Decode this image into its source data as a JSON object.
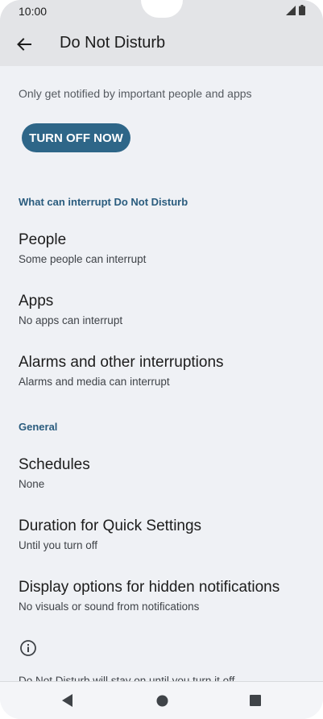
{
  "status_bar": {
    "time": "10:00",
    "icons": [
      "signal-icon",
      "battery-icon"
    ]
  },
  "app_bar": {
    "back_icon": "arrow-back-icon",
    "title": "Do Not Disturb"
  },
  "intro_text": "Only get notified by important people and apps",
  "turn_off_button": "TURN OFF NOW",
  "sections": {
    "interrupt_header": "What can interrupt Do Not Disturb",
    "general_header": "General"
  },
  "interrupt_items": [
    {
      "title": "People",
      "summary": "Some people can interrupt"
    },
    {
      "title": "Apps",
      "summary": "No apps can interrupt"
    },
    {
      "title": "Alarms and other interruptions",
      "summary": "Alarms and media can interrupt"
    }
  ],
  "general_items": [
    {
      "title": "Schedules",
      "summary": "None"
    },
    {
      "title": "Duration for Quick Settings",
      "summary": "Until you turn off"
    },
    {
      "title": "Display options for hidden notifications",
      "summary": "No visuals or sound from notifications"
    }
  ],
  "footer": {
    "icon": "info-icon",
    "text": "Do Not Disturb will stay on until you turn it off"
  },
  "nav_bar": {
    "icons": [
      "back-triangle-icon",
      "home-circle-icon",
      "recents-square-icon"
    ]
  },
  "colors": {
    "accent": "#2e6688",
    "section_header": "#2a5c7e",
    "background": "#eff1f5",
    "app_bar": "#e3e4e7"
  }
}
